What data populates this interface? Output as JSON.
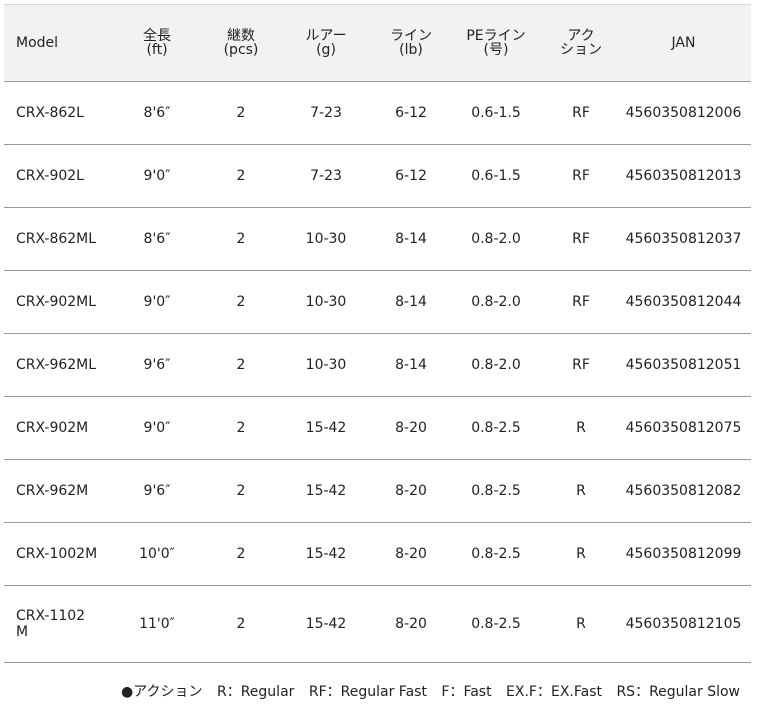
{
  "table": {
    "headers": [
      {
        "line1": "Model",
        "line2": ""
      },
      {
        "line1": "全長",
        "line2": "(ft)"
      },
      {
        "line1": "継数",
        "line2": "(pcs)"
      },
      {
        "line1": "ルアー",
        "line2": "(g)"
      },
      {
        "line1": "ライン",
        "line2": "(lb)"
      },
      {
        "line1": "PEライン",
        "line2": "(号)"
      },
      {
        "line1": "アク",
        "line2": "ション"
      },
      {
        "line1": "JAN",
        "line2": ""
      }
    ],
    "rows": [
      [
        "CRX-862L",
        "8'6″",
        "2",
        "7-23",
        "6-12",
        "0.6-1.5",
        "RF",
        "4560350812006"
      ],
      [
        "CRX-902L",
        "9'0″",
        "2",
        "7-23",
        "6-12",
        "0.6-1.5",
        "RF",
        "4560350812013"
      ],
      [
        "CRX-862ML",
        "8'6″",
        "2",
        "10-30",
        "8-14",
        "0.8-2.0",
        "RF",
        "4560350812037"
      ],
      [
        "CRX-902ML",
        "9'0″",
        "2",
        "10-30",
        "8-14",
        "0.8-2.0",
        "RF",
        "4560350812044"
      ],
      [
        "CRX-962ML",
        "9'6″",
        "2",
        "10-30",
        "8-14",
        "0.8-2.0",
        "RF",
        "4560350812051"
      ],
      [
        "CRX-902M",
        "9'0″",
        "2",
        "15-42",
        "8-20",
        "0.8-2.5",
        "R",
        "4560350812075"
      ],
      [
        "CRX-962M",
        "9'6″",
        "2",
        "15-42",
        "8-20",
        "0.8-2.5",
        "R",
        "4560350812082"
      ],
      [
        "CRX-1002M",
        "10'0″",
        "2",
        "15-42",
        "8-20",
        "0.8-2.5",
        "R",
        "4560350812099"
      ],
      [
        "CRX-1102M",
        "11'0″",
        "2",
        "15-42",
        "8-20",
        "0.8-2.5",
        "R",
        "4560350812105"
      ]
    ]
  },
  "legend": {
    "bullet": "●",
    "title": "アクション",
    "items": [
      "R：Regular",
      "RF：Regular Fast",
      "F：Fast",
      "EX.F：EX.Fast",
      "RS：Regular Slow"
    ]
  }
}
